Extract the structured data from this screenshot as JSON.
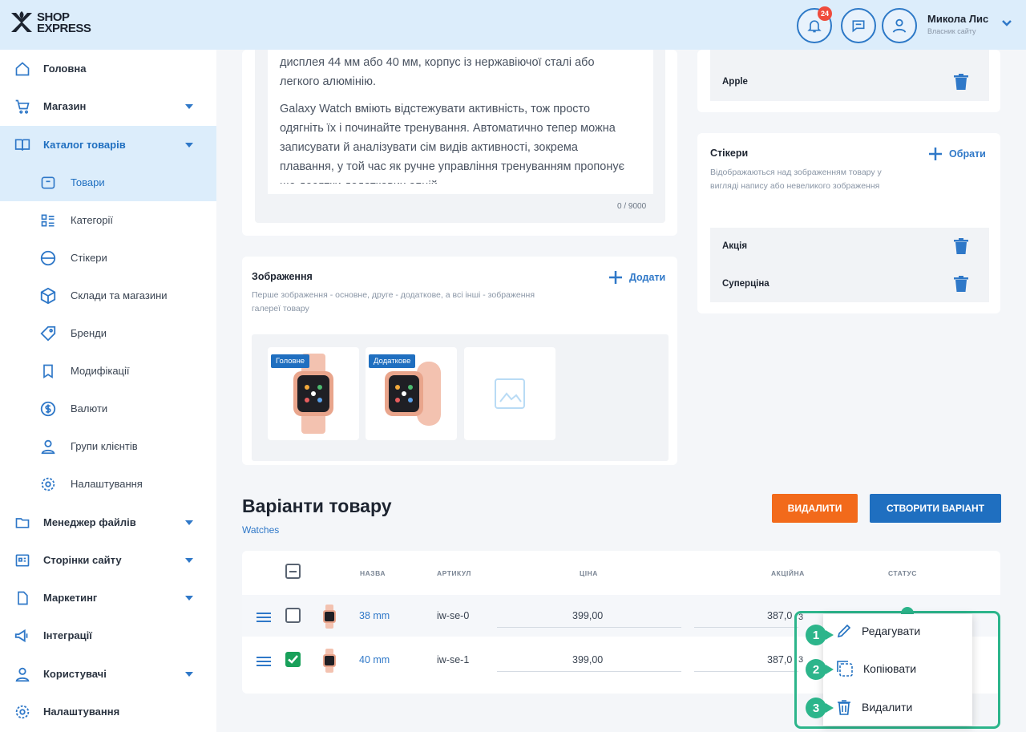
{
  "header": {
    "logo_line1": "SHOP",
    "logo_line2": "EXPRESS",
    "notification_count": "24",
    "user_name": "Микола Лис",
    "user_role": "Власник сайту"
  },
  "sidebar": {
    "items": [
      {
        "label": "Головна",
        "icon": "home-icon"
      },
      {
        "label": "Магазин",
        "icon": "cart-icon"
      },
      {
        "label": "Каталог товарів",
        "icon": "book-icon"
      },
      {
        "label": "Товари",
        "icon": "box-icon"
      },
      {
        "label": "Категорії",
        "icon": "list-icon"
      },
      {
        "label": "Стікери",
        "icon": "sticker-icon"
      },
      {
        "label": "Склади та магазини",
        "icon": "package-icon"
      },
      {
        "label": "Бренди",
        "icon": "tag-icon"
      },
      {
        "label": "Модифікації",
        "icon": "bookmark-icon"
      },
      {
        "label": "Валюти",
        "icon": "dollar-icon"
      },
      {
        "label": "Групи клієнтів",
        "icon": "users-icon"
      },
      {
        "label": "Налаштування",
        "icon": "gear-icon"
      },
      {
        "label": "Менеджер файлів",
        "icon": "folder-icon"
      },
      {
        "label": "Сторінки сайту",
        "icon": "pages-icon"
      },
      {
        "label": "Маркетинг",
        "icon": "marketing-icon"
      },
      {
        "label": "Інтеграції",
        "icon": "megaphone-icon"
      },
      {
        "label": "Користувачі",
        "icon": "user-icon"
      },
      {
        "label": "Налаштування",
        "icon": "gear-icon"
      }
    ]
  },
  "description": {
    "paragraph1": "дисплея 44 мм або 40 мм, корпус із нержавіючої сталі або легкого алюмінію.",
    "paragraph2": "Galaxy Watch вміють відстежувати активність, тож просто одягніть їх і починайте тренування. Автоматично тепер можна записувати й аналізувати сім видів активності, зокрема плавання, у той час як ручне управління тренуванням пропонує ще десятки додаткових опцій.",
    "counter": "0 / 9000"
  },
  "brand_card": {
    "brand": "Apple"
  },
  "stickers": {
    "title": "Стікери",
    "subtitle": "Відображаються над зображенням товару у вигляді напису або невеликого зображення",
    "choose_label": "Обрати",
    "items": [
      "Акція",
      "Суперціна"
    ]
  },
  "images": {
    "title": "Зображення",
    "subtitle": "Перше зображення - основне, друге - додаткове, а всі інші - зображення галереї товару",
    "add_label": "Додати",
    "tag_main": "Головне",
    "tag_extra": "Додаткове"
  },
  "variants": {
    "title": "Варіанти товару",
    "subtitle": "Watches",
    "delete_label": "ВИДАЛИТИ",
    "create_label": "СТВОРИТИ ВАРІАНТ",
    "columns": {
      "name": "НАЗВА",
      "sku": "АРТИКУЛ",
      "price": "ЦІНА",
      "sale": "АКЦІЙНА",
      "status": "СТАТУС"
    },
    "rows": [
      {
        "name": "38 mm",
        "sku": "iw-se-0",
        "price": "399,00",
        "sale": "387,0",
        "checked": false
      },
      {
        "name": "40 mm",
        "sku": "iw-se-1",
        "price": "399,00",
        "sale": "387,0",
        "checked": true
      }
    ]
  },
  "context_menu": {
    "items": [
      {
        "num": "1",
        "label": "Редагувати",
        "icon": "pencil-icon"
      },
      {
        "num": "2",
        "label": "Копіювати",
        "icon": "copy-icon"
      },
      {
        "num": "3",
        "label": "Видалити",
        "icon": "trash-icon"
      }
    ],
    "overflow_mark": "3"
  }
}
